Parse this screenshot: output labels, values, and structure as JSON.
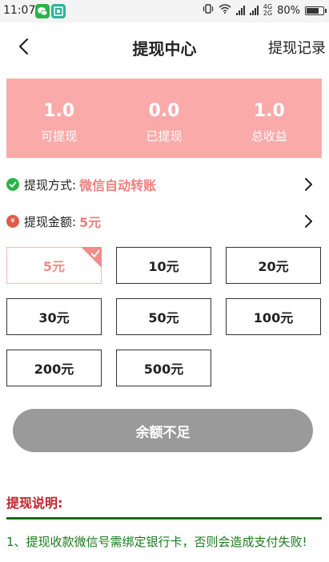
{
  "status": {
    "time": "11:07",
    "network": [
      "4G",
      "2G"
    ],
    "battery": "80%",
    "battery_level": 0.8
  },
  "header": {
    "title": "提现中心",
    "record_link": "提现记录"
  },
  "summary": [
    {
      "value": "1.0",
      "label": "可提现"
    },
    {
      "value": "0.0",
      "label": "已提现"
    },
    {
      "value": "1.0",
      "label": "总收益"
    }
  ],
  "method": {
    "label": "提现方式:",
    "value": "微信自动转账",
    "icon": "wechat-pay-icon"
  },
  "amount_row": {
    "label": "提现金额:",
    "value": "5元",
    "icon_text": "¥"
  },
  "amounts": [
    {
      "label": "5元",
      "selected": true
    },
    {
      "label": "10元",
      "selected": false
    },
    {
      "label": "20元",
      "selected": false
    },
    {
      "label": "30元",
      "selected": false
    },
    {
      "label": "50元",
      "selected": false
    },
    {
      "label": "100元",
      "selected": false
    },
    {
      "label": "200元",
      "selected": false
    },
    {
      "label": "500元",
      "selected": false
    }
  ],
  "submit": {
    "label": "余额不足"
  },
  "notes": {
    "title": "提现说明:",
    "items": [
      "1、提现收款微信号需绑定银行卡，否则会造成支付失败!"
    ]
  },
  "colors": {
    "summary_bg": "#fbaaaa",
    "accent": "#f07f7f",
    "button_disabled": "#9a9a9a",
    "notes_title": "#c0222c",
    "notes_text": "#1a7a1a"
  }
}
